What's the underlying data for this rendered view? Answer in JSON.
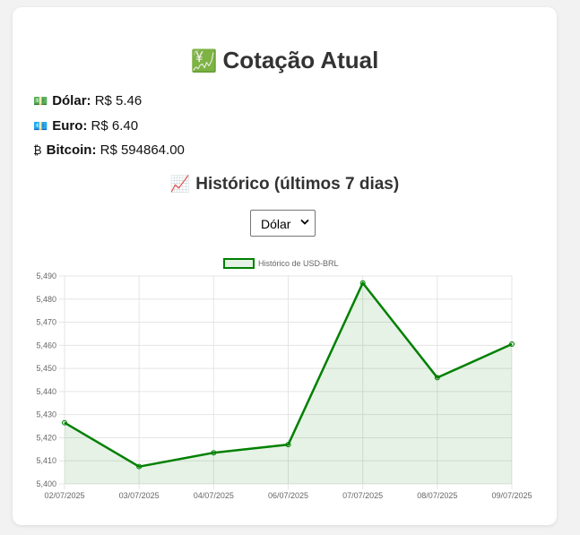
{
  "header": {
    "title": "Cotação Atual",
    "title_icon": "💹"
  },
  "rates": [
    {
      "icon": "💵",
      "label": "Dólar:",
      "value": "R$ 5.46"
    },
    {
      "icon": "💶",
      "label": "Euro:",
      "value": "R$ 6.40"
    },
    {
      "icon": "₿",
      "label": "Bitcoin:",
      "value": "R$ 594864.00"
    }
  ],
  "history": {
    "title": "Histórico (últimos 7 dias)",
    "title_icon": "📈",
    "select_value": "Dólar"
  },
  "colors": {
    "line": "#008000",
    "fill": "rgba(0,128,0,0.1)",
    "grid": "#e5e5e5"
  },
  "chart_data": {
    "type": "line",
    "categories": [
      "02/07/2025",
      "03/07/2025",
      "04/07/2025",
      "06/07/2025",
      "07/07/2025",
      "08/07/2025",
      "09/07/2025"
    ],
    "series": [
      {
        "name": "Histórico de USD-BRL",
        "values": [
          5.4265,
          5.4075,
          5.4135,
          5.417,
          5.487,
          5.446,
          5.4605
        ]
      }
    ],
    "ylim": [
      5.4,
      5.49
    ],
    "yticks": [
      "5,490",
      "5,480",
      "5,470",
      "5,460",
      "5,450",
      "5,440",
      "5,430",
      "5,420",
      "5,410",
      "5,400"
    ],
    "fill": true,
    "grid": true,
    "legend": "top"
  }
}
